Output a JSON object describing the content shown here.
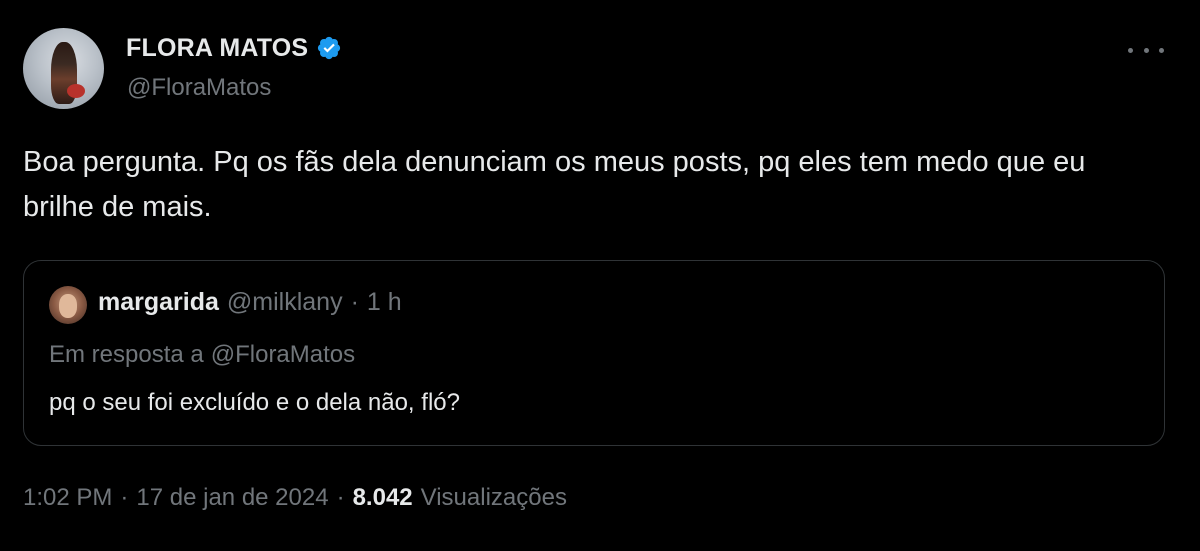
{
  "author": {
    "display_name": "FLORA MATOS",
    "handle": "@FloraMatos",
    "verified": true
  },
  "tweet": {
    "text": "Boa pergunta. Pq os fãs dela denunciam os meus posts, pq eles tem medo que eu brilhe de mais."
  },
  "quoted": {
    "display_name": "margarida",
    "handle": "@milklany",
    "separator": "·",
    "time": "1 h",
    "reply_prefix": "Em resposta a",
    "reply_to": "@FloraMatos",
    "text": "pq o seu foi excluído e o dela não, fló?"
  },
  "meta": {
    "time": "1:02 PM",
    "date": "17 de jan de 2024",
    "separator": "·",
    "views_count": "8.042",
    "views_label": "Visualizações"
  },
  "icons": {
    "verified": "verified-badge-icon",
    "more": "more-options-icon"
  },
  "colors": {
    "background": "#000000",
    "primary_text": "#e7e9ea",
    "secondary_text": "#71767b",
    "border": "#2f3336",
    "verified_blue": "#1d9bf0"
  }
}
